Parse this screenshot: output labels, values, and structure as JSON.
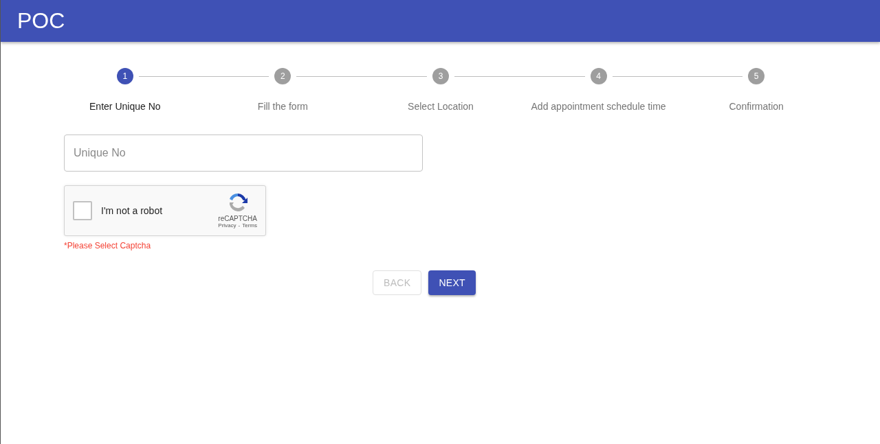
{
  "app_bar": {
    "title": "POC"
  },
  "stepper": {
    "steps": [
      {
        "number": "1",
        "label": "Enter Unique No",
        "selected": true
      },
      {
        "number": "2",
        "label": "Fill the form",
        "selected": false
      },
      {
        "number": "3",
        "label": "Select Location",
        "selected": false
      },
      {
        "number": "4",
        "label": "Add appointment schedule time",
        "selected": false
      },
      {
        "number": "5",
        "label": "Confirmation",
        "selected": false
      }
    ]
  },
  "unique_no_field": {
    "placeholder": "Unique No"
  },
  "captcha": {
    "label": "I'm not a robot",
    "checked": false,
    "brand": "reCAPTCHA",
    "privacy_link": "Privacy",
    "separator": "-",
    "terms_link": "Terms"
  },
  "error": "*Please Select Captcha",
  "buttons": [
    {
      "label": "BACK",
      "disabled": true
    },
    {
      "label": "NEXT",
      "disabled": false
    }
  ]
}
